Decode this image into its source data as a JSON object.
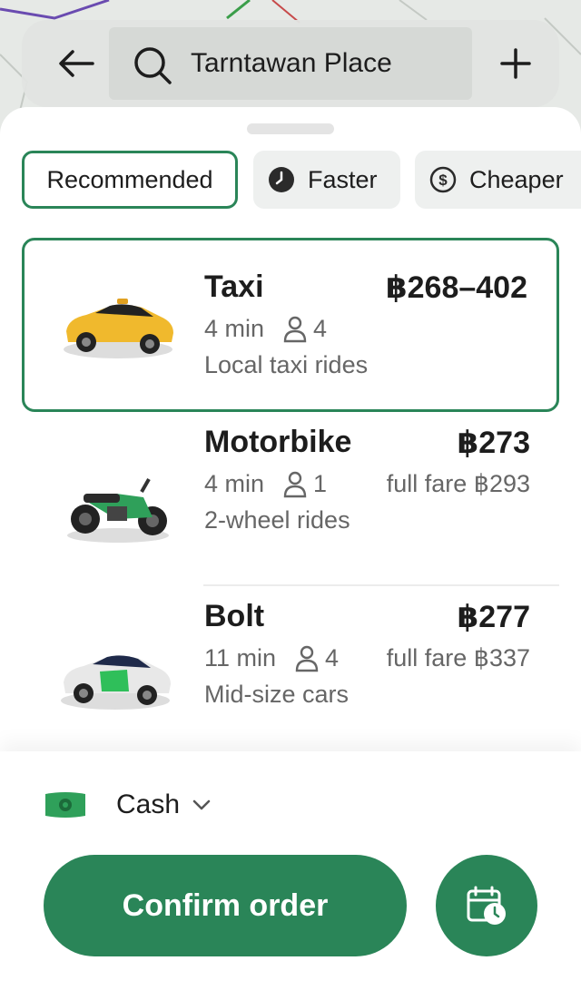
{
  "search": {
    "value": "Tarntawan Place"
  },
  "filters": [
    {
      "label": "Recommended",
      "icon": "",
      "active": true
    },
    {
      "label": "Faster",
      "icon": "clock-icon",
      "active": false
    },
    {
      "label": "Cheaper",
      "icon": "dollar-icon",
      "active": false
    }
  ],
  "rides": [
    {
      "name": "Taxi",
      "price": "฿268–402",
      "eta": "4 min",
      "seats": "4",
      "full_fare": "",
      "description": "Local taxi rides",
      "image": "yellow-taxi-car"
    },
    {
      "name": "Motorbike",
      "price": "฿273",
      "eta": "4 min",
      "seats": "1",
      "full_fare": "full fare ฿293",
      "description": "2-wheel rides",
      "image": "green-motorbike"
    },
    {
      "name": "Bolt",
      "price": "฿277",
      "eta": "11 min",
      "seats": "4",
      "full_fare": "full fare ฿337",
      "description": "Mid-size cars",
      "image": "white-green-car"
    }
  ],
  "payment": {
    "method": "Cash",
    "icon": "cash-icon"
  },
  "confirm_label": "Confirm order",
  "colors": {
    "accent": "#2a8558",
    "muted_text": "#666666",
    "chip_bg": "#eef0ef"
  }
}
